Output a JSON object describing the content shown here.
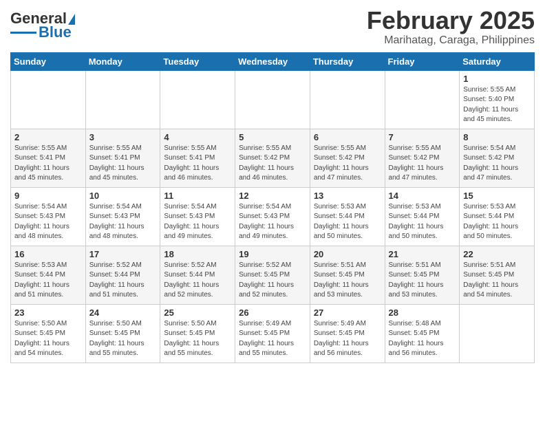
{
  "header": {
    "logo_line1": "General",
    "logo_line2": "Blue",
    "month": "February 2025",
    "location": "Marihatag, Caraga, Philippines"
  },
  "weekdays": [
    "Sunday",
    "Monday",
    "Tuesday",
    "Wednesday",
    "Thursday",
    "Friday",
    "Saturday"
  ],
  "weeks": [
    [
      {
        "day": "",
        "info": ""
      },
      {
        "day": "",
        "info": ""
      },
      {
        "day": "",
        "info": ""
      },
      {
        "day": "",
        "info": ""
      },
      {
        "day": "",
        "info": ""
      },
      {
        "day": "",
        "info": ""
      },
      {
        "day": "1",
        "info": "Sunrise: 5:55 AM\nSunset: 5:40 PM\nDaylight: 11 hours and 45 minutes."
      }
    ],
    [
      {
        "day": "2",
        "info": "Sunrise: 5:55 AM\nSunset: 5:41 PM\nDaylight: 11 hours and 45 minutes."
      },
      {
        "day": "3",
        "info": "Sunrise: 5:55 AM\nSunset: 5:41 PM\nDaylight: 11 hours and 45 minutes."
      },
      {
        "day": "4",
        "info": "Sunrise: 5:55 AM\nSunset: 5:41 PM\nDaylight: 11 hours and 46 minutes."
      },
      {
        "day": "5",
        "info": "Sunrise: 5:55 AM\nSunset: 5:42 PM\nDaylight: 11 hours and 46 minutes."
      },
      {
        "day": "6",
        "info": "Sunrise: 5:55 AM\nSunset: 5:42 PM\nDaylight: 11 hours and 47 minutes."
      },
      {
        "day": "7",
        "info": "Sunrise: 5:55 AM\nSunset: 5:42 PM\nDaylight: 11 hours and 47 minutes."
      },
      {
        "day": "8",
        "info": "Sunrise: 5:54 AM\nSunset: 5:42 PM\nDaylight: 11 hours and 47 minutes."
      }
    ],
    [
      {
        "day": "9",
        "info": "Sunrise: 5:54 AM\nSunset: 5:43 PM\nDaylight: 11 hours and 48 minutes."
      },
      {
        "day": "10",
        "info": "Sunrise: 5:54 AM\nSunset: 5:43 PM\nDaylight: 11 hours and 48 minutes."
      },
      {
        "day": "11",
        "info": "Sunrise: 5:54 AM\nSunset: 5:43 PM\nDaylight: 11 hours and 49 minutes."
      },
      {
        "day": "12",
        "info": "Sunrise: 5:54 AM\nSunset: 5:43 PM\nDaylight: 11 hours and 49 minutes."
      },
      {
        "day": "13",
        "info": "Sunrise: 5:53 AM\nSunset: 5:44 PM\nDaylight: 11 hours and 50 minutes."
      },
      {
        "day": "14",
        "info": "Sunrise: 5:53 AM\nSunset: 5:44 PM\nDaylight: 11 hours and 50 minutes."
      },
      {
        "day": "15",
        "info": "Sunrise: 5:53 AM\nSunset: 5:44 PM\nDaylight: 11 hours and 50 minutes."
      }
    ],
    [
      {
        "day": "16",
        "info": "Sunrise: 5:53 AM\nSunset: 5:44 PM\nDaylight: 11 hours and 51 minutes."
      },
      {
        "day": "17",
        "info": "Sunrise: 5:52 AM\nSunset: 5:44 PM\nDaylight: 11 hours and 51 minutes."
      },
      {
        "day": "18",
        "info": "Sunrise: 5:52 AM\nSunset: 5:44 PM\nDaylight: 11 hours and 52 minutes."
      },
      {
        "day": "19",
        "info": "Sunrise: 5:52 AM\nSunset: 5:45 PM\nDaylight: 11 hours and 52 minutes."
      },
      {
        "day": "20",
        "info": "Sunrise: 5:51 AM\nSunset: 5:45 PM\nDaylight: 11 hours and 53 minutes."
      },
      {
        "day": "21",
        "info": "Sunrise: 5:51 AM\nSunset: 5:45 PM\nDaylight: 11 hours and 53 minutes."
      },
      {
        "day": "22",
        "info": "Sunrise: 5:51 AM\nSunset: 5:45 PM\nDaylight: 11 hours and 54 minutes."
      }
    ],
    [
      {
        "day": "23",
        "info": "Sunrise: 5:50 AM\nSunset: 5:45 PM\nDaylight: 11 hours and 54 minutes."
      },
      {
        "day": "24",
        "info": "Sunrise: 5:50 AM\nSunset: 5:45 PM\nDaylight: 11 hours and 55 minutes."
      },
      {
        "day": "25",
        "info": "Sunrise: 5:50 AM\nSunset: 5:45 PM\nDaylight: 11 hours and 55 minutes."
      },
      {
        "day": "26",
        "info": "Sunrise: 5:49 AM\nSunset: 5:45 PM\nDaylight: 11 hours and 55 minutes."
      },
      {
        "day": "27",
        "info": "Sunrise: 5:49 AM\nSunset: 5:45 PM\nDaylight: 11 hours and 56 minutes."
      },
      {
        "day": "28",
        "info": "Sunrise: 5:48 AM\nSunset: 5:45 PM\nDaylight: 11 hours and 56 minutes."
      },
      {
        "day": "",
        "info": ""
      }
    ]
  ]
}
